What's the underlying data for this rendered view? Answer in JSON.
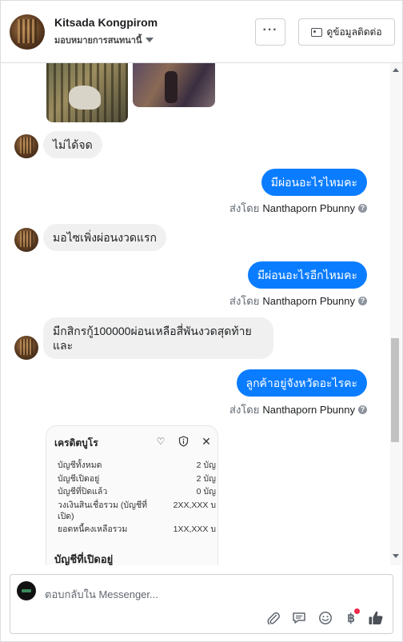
{
  "header": {
    "contact_name": "Kitsada Kongpirom",
    "assign_label": "มอบหมายการสนทนานี้",
    "more_label": "···",
    "contact_info_label": "ดูข้อมูลติดต่อ"
  },
  "messages": [
    {
      "dir": "in",
      "text": "ไม่ได้จด"
    },
    {
      "dir": "out",
      "text": "มีผ่อนอะไรไหมคะ",
      "sent_by_prefix": "ส่งโดย",
      "sent_by": "Nanthaporn Pbunny"
    },
    {
      "dir": "in",
      "text": "มอไซเพิ่งผ่อนงวดแรก"
    },
    {
      "dir": "out",
      "text": "มีผ่อนอะไรอีกไหมคะ",
      "sent_by_prefix": "ส่งโดย",
      "sent_by": "Nanthaporn Pbunny"
    },
    {
      "dir": "in",
      "text": "มีกสิกรกู้100000ผ่อนเหลือสี่พันงวดสุดท้ายและ"
    },
    {
      "dir": "out",
      "text": "ลูกค้าอยู่จังหวัดอะไรคะ",
      "sent_by_prefix": "ส่งโดย",
      "sent_by": "Nanthaporn Pbunny"
    }
  ],
  "credit_card": {
    "title": "เครดิตบูโร",
    "rows": [
      {
        "label": "บัญชีทั้งหมด",
        "value": "2 บัญ"
      },
      {
        "label": "บัญชีเปิดอยู่",
        "value": "2 บัญ"
      },
      {
        "label": "บัญชีที่ปิดแล้ว",
        "value": "0 บัญ"
      },
      {
        "label": "วงเงินสินเชื่อรวม (บัญชีที่เปิด)",
        "value": "2XX,XXX  บ"
      },
      {
        "label": "ยอดหนี้คงเหลือรวม",
        "value": "1XX,XXX  บ"
      }
    ],
    "section": "บัญชีที่เปิดอยู่",
    "icons": [
      "heart-icon",
      "info-icon",
      "close-icon"
    ]
  },
  "composer": {
    "placeholder": "ตอบกลับใน Messenger...",
    "tools": [
      "attach-icon",
      "saved-replies-icon",
      "emoji-icon",
      "payment-icon",
      "like-icon"
    ]
  }
}
